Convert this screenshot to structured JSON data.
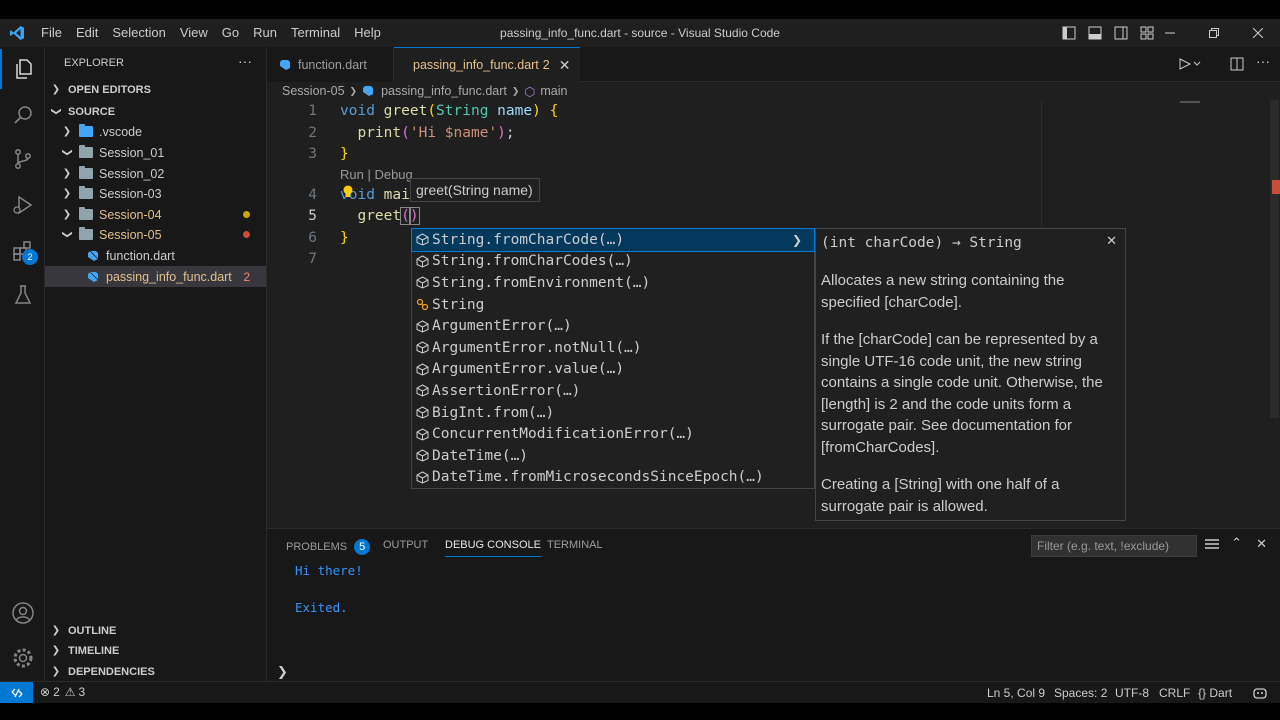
{
  "window": {
    "title": "passing_info_func.dart - source - Visual Studio Code"
  },
  "menu": [
    "File",
    "Edit",
    "Selection",
    "View",
    "Go",
    "Run",
    "Terminal",
    "Help"
  ],
  "activity": {
    "extensions_badge": "2"
  },
  "sidebar": {
    "header": "EXPLORER",
    "sections": {
      "open_editors": "OPEN EDITORS",
      "source": "SOURCE",
      "outline": "OUTLINE",
      "timeline": "TIMELINE",
      "dependencies": "DEPENDENCIES"
    },
    "tree": [
      {
        "label": ".vscode",
        "open": false,
        "color": "#cccccc"
      },
      {
        "label": "Session_01",
        "open": true,
        "color": "#cccccc"
      },
      {
        "label": "Session_02",
        "open": false,
        "color": "#cccccc"
      },
      {
        "label": "Session-03",
        "open": false,
        "color": "#cccccc"
      },
      {
        "label": "Session-04",
        "open": false,
        "color": "#e2c08d"
      },
      {
        "label": "Session-05",
        "open": true,
        "color": "#e2c08d"
      }
    ],
    "files": [
      {
        "label": "function.dart"
      },
      {
        "label": "passing_info_func.dart",
        "problems": "2"
      }
    ]
  },
  "tabs": [
    {
      "label": "function.dart"
    },
    {
      "label": "passing_info_func.dart",
      "problems": "2"
    }
  ],
  "breadcrumb": {
    "folder": "Session-05",
    "file": "passing_info_func.dart",
    "symbol": "main"
  },
  "code": {
    "line_numbers": [
      "1",
      "2",
      "3",
      "4",
      "5",
      "6",
      "7"
    ],
    "codelens": "Run | Debug",
    "print_string": "'Hi $name'"
  },
  "signature_help": "greet(String name)",
  "suggestions": [
    {
      "label": "String.fromCharCode(…)",
      "kind": "constructor"
    },
    {
      "label": "String.fromCharCodes(…)",
      "kind": "constructor"
    },
    {
      "label": "String.fromEnvironment(…)",
      "kind": "constructor"
    },
    {
      "label": "String",
      "kind": "class"
    },
    {
      "label": "ArgumentError(…)",
      "kind": "constructor"
    },
    {
      "label": "ArgumentError.notNull(…)",
      "kind": "constructor"
    },
    {
      "label": "ArgumentError.value(…)",
      "kind": "constructor"
    },
    {
      "label": "AssertionError(…)",
      "kind": "constructor"
    },
    {
      "label": "BigInt.from(…)",
      "kind": "constructor"
    },
    {
      "label": "ConcurrentModificationError(…)",
      "kind": "constructor"
    },
    {
      "label": "DateTime(…)",
      "kind": "constructor"
    },
    {
      "label": "DateTime.fromMicrosecondsSinceEpoch(…)",
      "kind": "constructor"
    }
  ],
  "docs": {
    "signature": "(int charCode) → String",
    "paragraphs": [
      "Allocates a new string containing the specified [charCode].",
      "If the [charCode] can be represented by a single UTF-16 code unit, the new string contains a single code unit. Otherwise, the [length] is 2 and the code units form a surrogate pair. See documentation for [fromCharCodes].",
      "Creating a [String] with one half of a surrogate pair is allowed."
    ]
  },
  "panel": {
    "tabs": {
      "problems": "PROBLEMS",
      "output": "OUTPUT",
      "debug": "DEBUG CONSOLE",
      "terminal": "TERMINAL"
    },
    "problems_count": "5",
    "filter_placeholder": "Filter (e.g. text, !exclude)",
    "console": [
      "Hi there!",
      "Exited."
    ]
  },
  "status": {
    "errors": "2",
    "warnings": "3",
    "position": "Ln 5, Col 9",
    "spaces": "Spaces: 2",
    "encoding": "UTF-8",
    "eol": "CRLF",
    "language": "Dart"
  },
  "colors": {
    "accent": "#0078d4",
    "modified": "#e2c08d",
    "error_dot": "#c74e39",
    "warning_dot": "#cca700"
  }
}
